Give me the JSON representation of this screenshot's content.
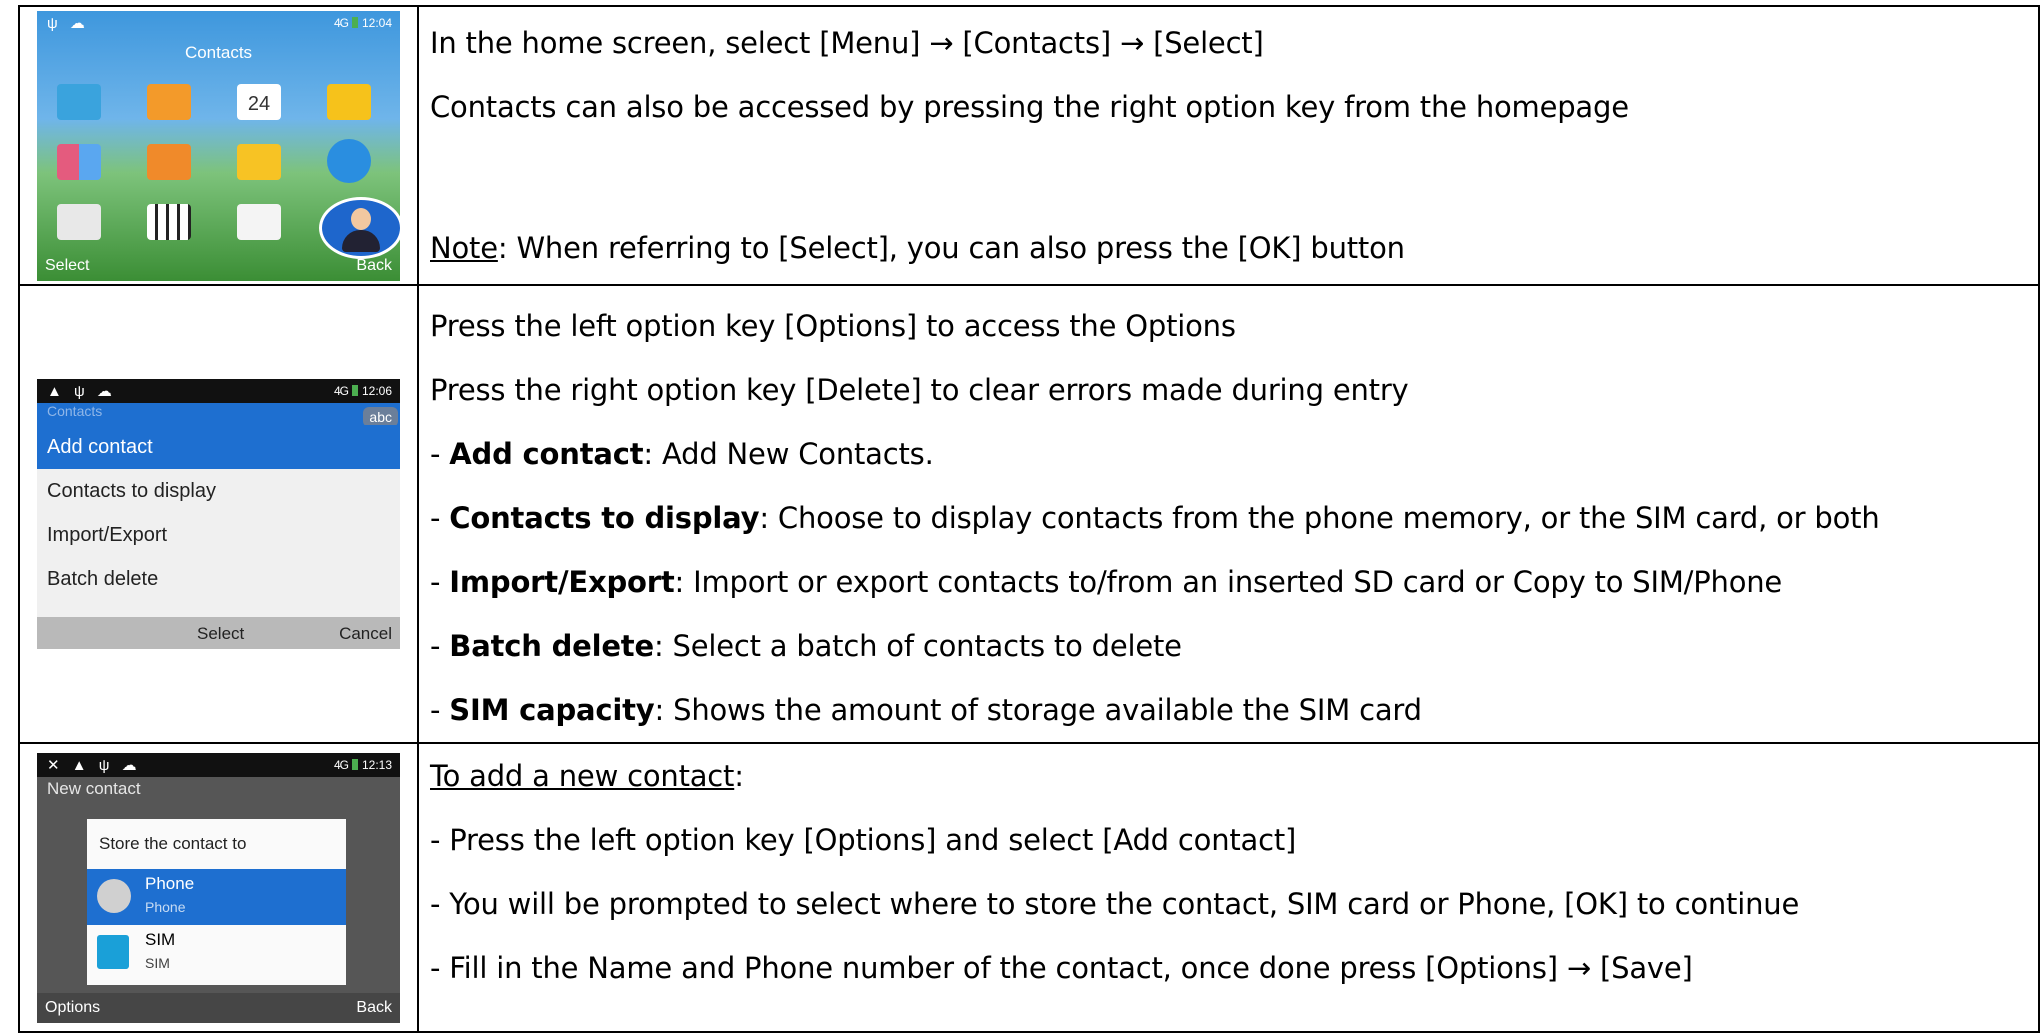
{
  "rows": [
    {
      "screen": {
        "title": "Contacts",
        "status_time": "12:04",
        "status_network": "4G",
        "soft_left": "Select",
        "soft_right": "Back",
        "calendar_day": "24"
      },
      "lines": {
        "l1": "In the home screen, select [Menu] → [Contacts] → [Select]",
        "l2": "Contacts can also be accessed by pressing the right option key from the homepage",
        "note_label": "Note",
        "note_text": ": When referring to [Select], you can also press the [OK] button"
      }
    },
    {
      "screen": {
        "header_behind": "Contacts",
        "status_time": "12:06",
        "status_network": "4G",
        "input_badge": "abc",
        "items": [
          "Add contact",
          "Contacts to display",
          "Import/Export",
          "Batch delete"
        ],
        "soft_mid": "Select",
        "soft_right": "Cancel"
      },
      "lines": {
        "l1": "Press the left option key [Options] to access the Options",
        "l2": "Press the right option key [Delete] to clear errors made during entry",
        "items": [
          {
            "term": "Add contact",
            "desc": ": Add New Contacts."
          },
          {
            "term": "Contacts to display",
            "desc": ": Choose to display contacts from the phone memory, or the SIM card, or both"
          },
          {
            "term": "Import/Export",
            "desc": ": Import or export contacts to/from an inserted SD card or Copy to SIM/Phone"
          },
          {
            "term": "Batch delete",
            "desc": ": Select a batch of contacts to delete"
          },
          {
            "term": "SIM capacity",
            "desc": ": Shows the amount of storage available the SIM card"
          }
        ]
      }
    },
    {
      "screen": {
        "title": "New contact",
        "status_time": "12:13",
        "status_network": "4G",
        "dialog_title": "Store the contact to",
        "options": [
          {
            "name": "Phone",
            "sub": "Phone"
          },
          {
            "name": "SIM",
            "sub": "SIM"
          }
        ],
        "soft_left": "Options",
        "soft_right": "Back"
      },
      "lines": {
        "heading": "To add a new contact",
        "heading_colon": ":",
        "l1": "- Press the left option key [Options] and select [Add contact]",
        "l2": "- You will be prompted to select where to store the contact, SIM card or Phone, [OK] to continue",
        "l3": "- Fill in the Name and Phone number of the contact, once done press [Options] → [Save]"
      }
    }
  ],
  "bullet_prefix": "- ",
  "colors": {
    "highlight": "#1e6fd0",
    "border": "#000000"
  }
}
